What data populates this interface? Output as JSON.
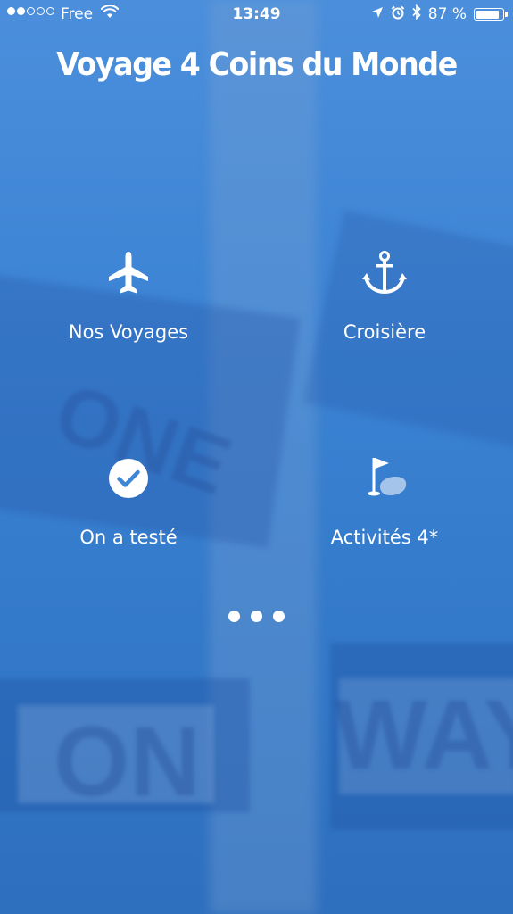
{
  "status_bar": {
    "signal_dots_filled": 2,
    "signal_dots_total": 5,
    "carrier": "Free",
    "time": "13:49",
    "battery_percent": "87 %",
    "battery_level": 0.87
  },
  "header": {
    "title": "Voyage 4 Coins du Monde"
  },
  "menu": {
    "items": [
      {
        "label": "Nos Voyages",
        "icon": "airplane-icon"
      },
      {
        "label": "Croisière",
        "icon": "anchor-icon"
      },
      {
        "label": "On a testé",
        "icon": "checkmark-circle-icon"
      },
      {
        "label": "Activités 4*",
        "icon": "golf-flag-icon"
      }
    ]
  },
  "pager": {
    "dots": 3
  },
  "colors": {
    "background": "#3f86d4",
    "foreground": "#ffffff"
  }
}
